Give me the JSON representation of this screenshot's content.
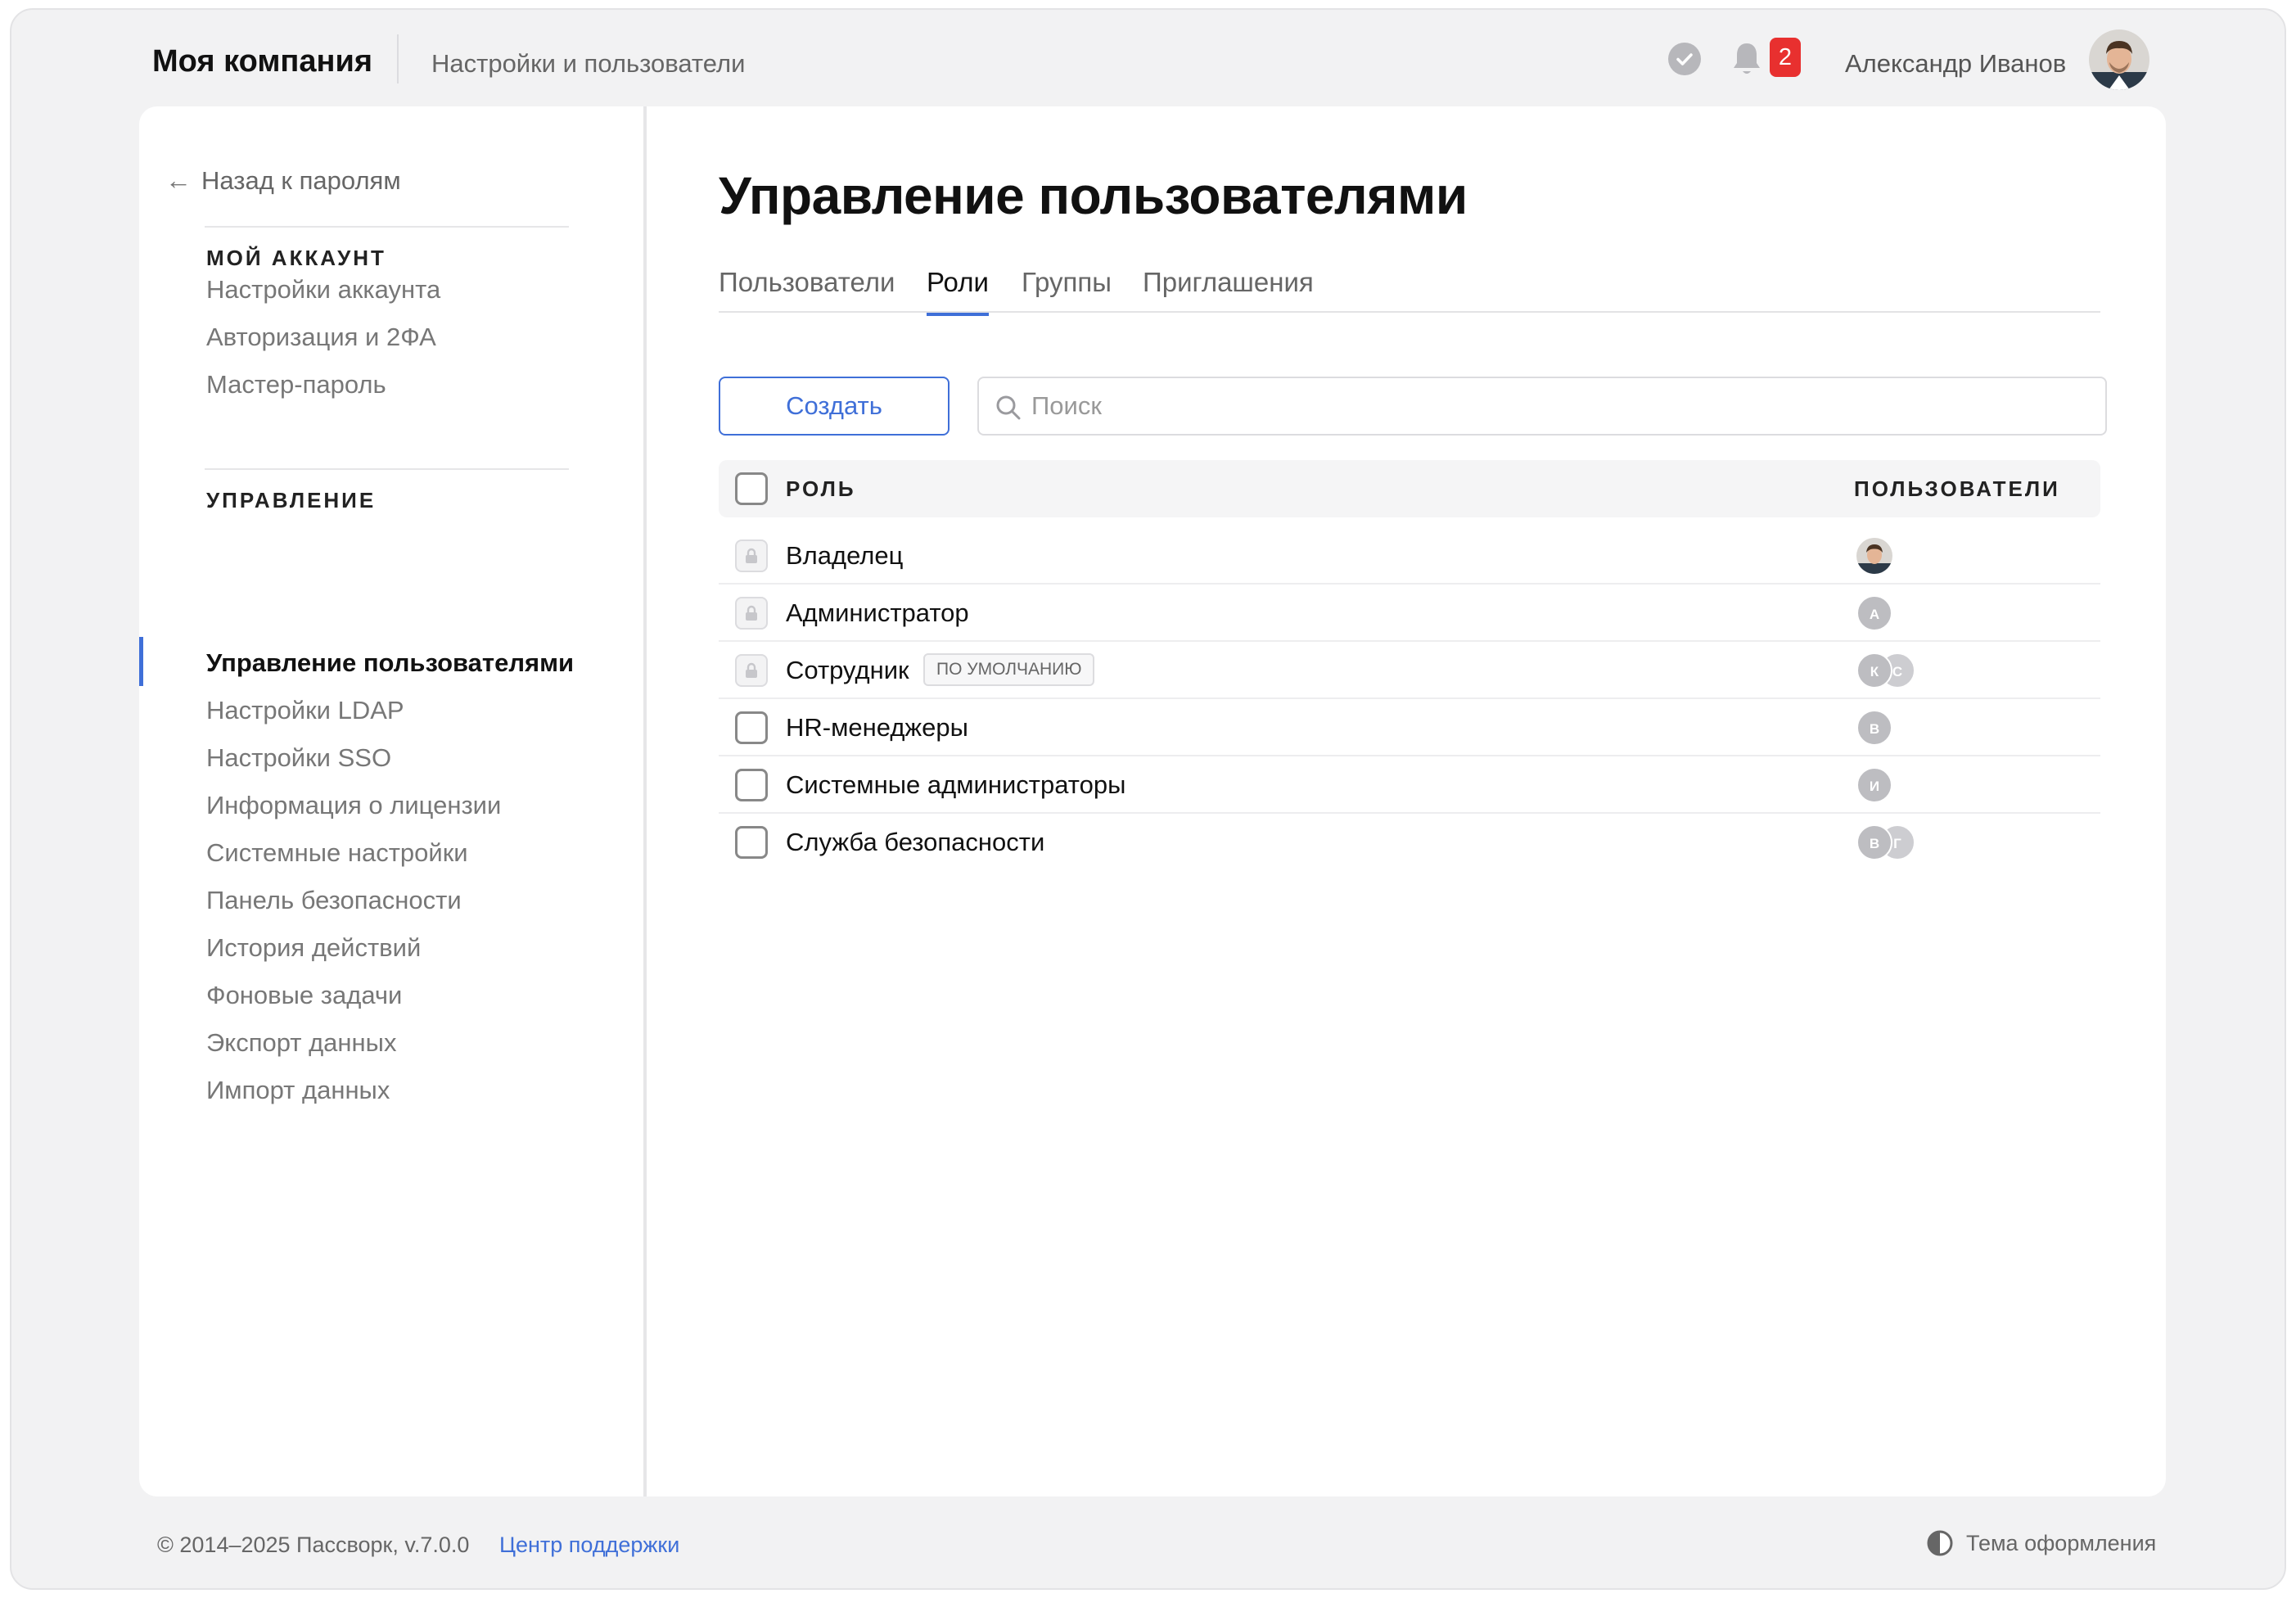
{
  "header": {
    "brand": "Моя компания",
    "section": "Настройки и пользователи",
    "notifications_count": "2",
    "user_name": "Александр Иванов",
    "icons": [
      "check-circle-icon",
      "bell-icon",
      "avatar"
    ]
  },
  "sidebar": {
    "back_label": "Назад к паролям",
    "account_heading": "МОЙ АККАУНТ",
    "account_items": [
      "Настройки аккаунта",
      "Авторизация и 2ФА",
      "Мастер-пароль"
    ],
    "management_heading": "УПРАВЛЕНИЕ",
    "management_items": [
      "Управление пользователями",
      "Настройки LDAP",
      "Настройки SSO",
      "Информация о лицензии",
      "Системные настройки",
      "Панель безопасности",
      "История действий",
      "Фоновые задачи",
      "Экспорт данных",
      "Импорт данных"
    ],
    "active_item": "Управление пользователями"
  },
  "main": {
    "title": "Управление пользователями",
    "tabs": [
      "Пользователи",
      "Роли",
      "Группы",
      "Приглашения"
    ],
    "active_tab": "Роли",
    "create_label": "Создать",
    "search_placeholder": "Поиск",
    "table": {
      "headers": [
        "РОЛЬ",
        "ПОЛЬЗОВАТЕЛИ"
      ],
      "rows": [
        {
          "name": "Владелец",
          "locked": true,
          "badge": "",
          "users": [
            "photo"
          ]
        },
        {
          "name": "Администратор",
          "locked": true,
          "badge": "",
          "users": [
            "А"
          ]
        },
        {
          "name": "Сотрудник",
          "locked": true,
          "badge": "ПО УМОЛЧАНИЮ",
          "users": [
            "К",
            "С"
          ]
        },
        {
          "name": "HR-менеджеры",
          "locked": false,
          "badge": "",
          "users": [
            "В"
          ]
        },
        {
          "name": "Системные администраторы",
          "locked": false,
          "badge": "",
          "users": [
            "И"
          ]
        },
        {
          "name": "Служба безопасности",
          "locked": false,
          "badge": "",
          "users": [
            "В",
            "Г"
          ]
        }
      ]
    }
  },
  "footer": {
    "copyright": "© 2014–2025 Пассворк, v.7.0.0",
    "support_link": "Центр поддержки",
    "theme_label": "Тема оформления"
  },
  "colors": {
    "accent": "#3f6fd8",
    "badge_red": "#e8302f",
    "avatar_grey": "#bdbdc1",
    "page_bg": "#f2f2f3"
  }
}
